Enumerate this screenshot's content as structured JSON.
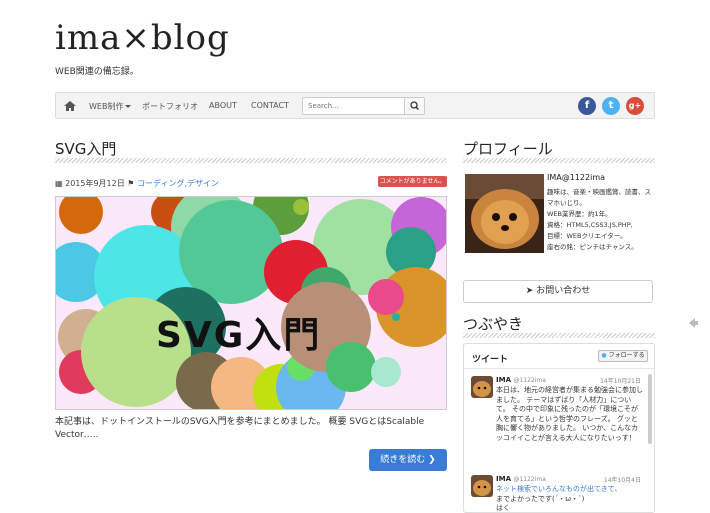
{
  "site": {
    "title": "ima×blog",
    "tagline": "WEB関連の備忘録。"
  },
  "nav": {
    "items": [
      "WEB制作",
      "ポートフォリオ",
      "ABOUT",
      "CONTACT"
    ],
    "search_placeholder": "Search..."
  },
  "social": [
    "f",
    "t",
    "g+"
  ],
  "post": {
    "title": "SVG入門",
    "date": "2015年9月12日",
    "categories": "コーディング,デザイン",
    "comment_badge": "コメントがありません。",
    "thumb_title": "SVG入門",
    "excerpt": "本記事は、ドットインストールのSVG入門を参考にまとめました。 概要 SVGとはScalable Vector…..",
    "read_more": "続きを読む"
  },
  "profile": {
    "heading": "プロフィール",
    "name": "IMA@1122ima",
    "lines": [
      "趣味は、音楽・映画鑑賞、読書、スマホいじり。",
      "WEB業界歴：約1年。",
      "資格：HTML5,CSS3,JS,PHP,",
      "目標：WEBクリエイター。",
      "座右の銘：ピンチはチャンス。"
    ],
    "contact": "お問い合わせ"
  },
  "tweets_heading": "つぶやき",
  "twitter": {
    "header": "ツイート",
    "follow": "フォローする",
    "tweets": [
      {
        "name": "IMA",
        "handle": "@1122ima",
        "date": "14年10月21日",
        "text": "本日は、地元の経営者が集まる勉強会に参加しました。 テーマはずばり「人材力」について。 その中で印象に残ったのが「環境こそが人を育てる」という哲学のフレーズ。 グッと胸に響く物がありました。 いつか、こんなカッコイイことが言える大人になりたいっす！"
      },
      {
        "name": "IMA",
        "handle": "@1122ima",
        "date": "14年10月4日",
        "link": "ネット検索でいろんなものが出てきて、",
        "text": "までよかったです(´・ω・`)",
        "tail": "はく"
      }
    ]
  },
  "colors": {
    "accent": "#3a7bd5",
    "badge": "#d9534f",
    "facebook": "#3b5998",
    "twitter": "#4ab3f4",
    "google": "#dd4b39"
  }
}
